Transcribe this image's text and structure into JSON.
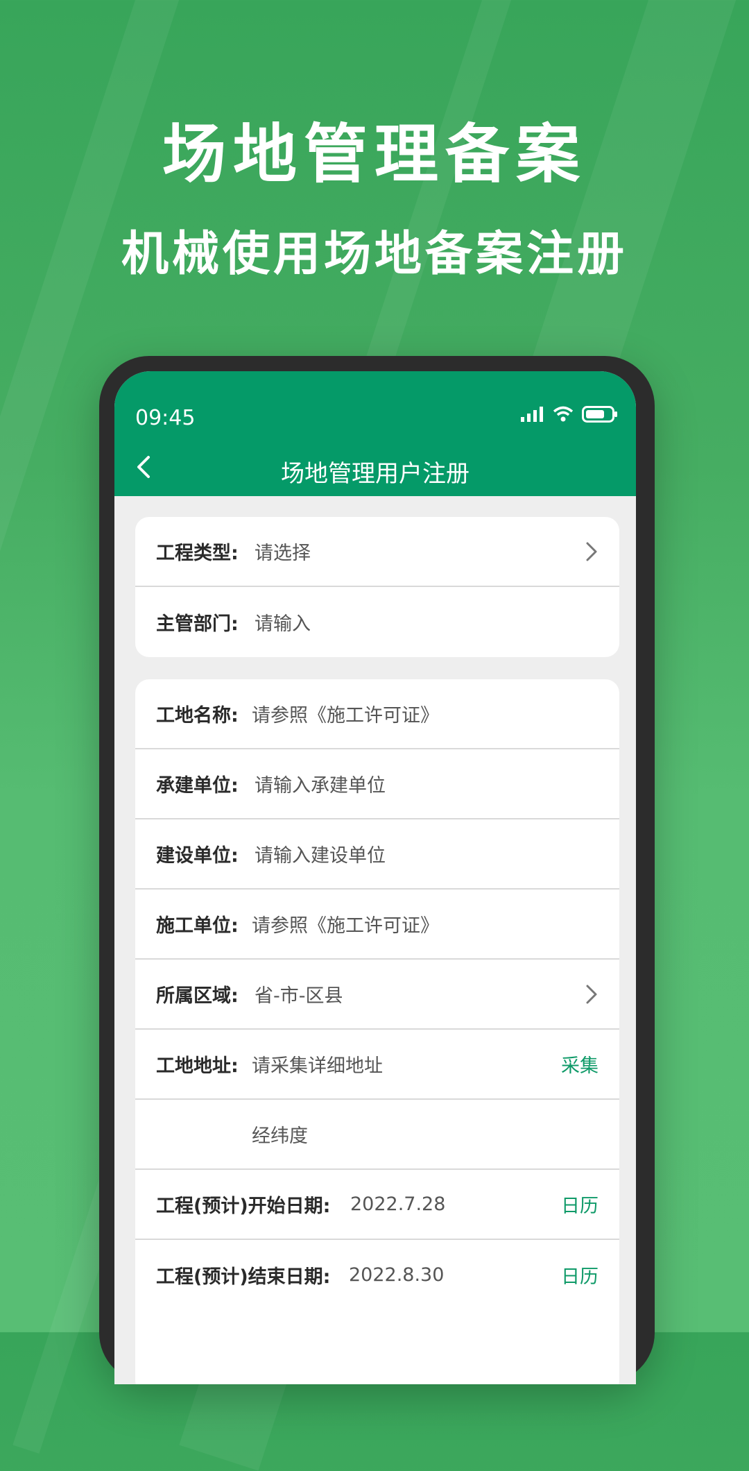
{
  "headline": {
    "title": "场地管理备案",
    "subtitle": "机械使用场地备案注册"
  },
  "status_bar": {
    "time": "09:45",
    "icons": [
      "signal-icon",
      "wifi-icon",
      "battery-icon"
    ]
  },
  "app_bar": {
    "title": "场地管理用户注册",
    "back_icon": "chevron-left-icon"
  },
  "card1": {
    "rows": [
      {
        "label": "工程类型:",
        "value": "请选择"
      },
      {
        "label": "主管部门:",
        "value": "请输入"
      }
    ]
  },
  "card2": {
    "rows": [
      {
        "label": "工地名称:",
        "value": "请参照《施工许可证》"
      },
      {
        "label": "承建单位:",
        "value": "请输入承建单位"
      },
      {
        "label": "建设单位:",
        "value": "请输入建设单位"
      },
      {
        "label": "施工单位:",
        "value": "请参照《施工许可证》"
      },
      {
        "label": "所属区域:",
        "value": "省-市-区县"
      },
      {
        "label": "工地地址:",
        "value": "请采集详细地址",
        "action": "采集"
      },
      {
        "label": "",
        "value": "经纬度"
      },
      {
        "label": "工程(预计)开始日期:",
        "value": "2022.7.28",
        "action": "日历"
      },
      {
        "label": "工程(预计)结束日期:",
        "value": "2022.8.30",
        "action": "日历"
      }
    ]
  },
  "colors": {
    "primary": "#059a68",
    "accent_text": "#0f9a68",
    "background_green": "#46ad62"
  }
}
